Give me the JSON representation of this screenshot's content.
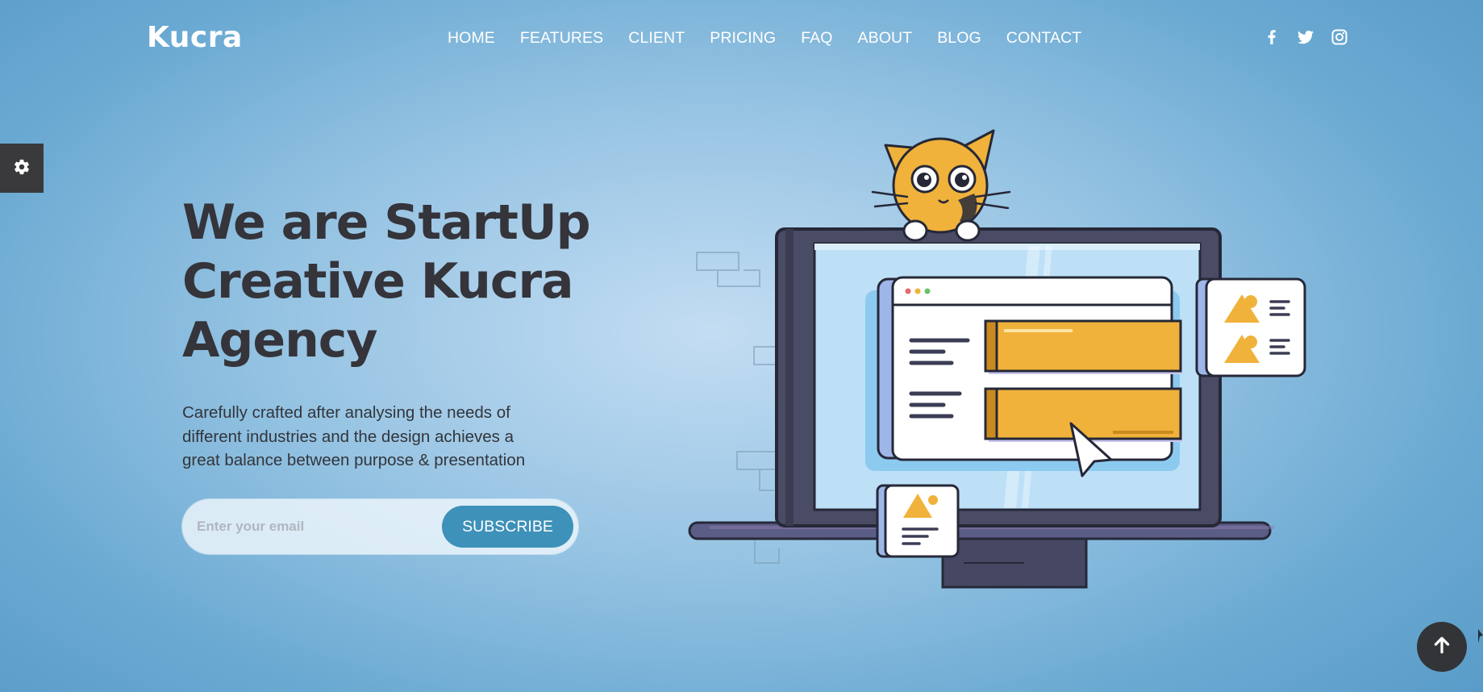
{
  "brand": {
    "logo_text": "Kucra"
  },
  "nav": {
    "items": [
      "HOME",
      "FEATURES",
      "CLIENT",
      "PRICING",
      "FAQ",
      "ABOUT",
      "BLOG",
      "CONTACT"
    ]
  },
  "social": {
    "icons": [
      "facebook-icon",
      "twitter-icon",
      "instagram-icon"
    ]
  },
  "settings_panel": {
    "icon": "gear-icon"
  },
  "hero": {
    "title_lines": [
      "We are StartUp",
      "Creative Kucra",
      "Agency"
    ],
    "description_lines": [
      "Carefully crafted after analysing the needs of",
      "different industries and the design achieves a",
      "great balance between purpose & presentation"
    ],
    "email_placeholder": "Enter your email",
    "subscribe_label": "SUBSCRIBE"
  },
  "back_to_top": {
    "icon": "arrow-up-icon"
  },
  "colors": {
    "background_center": "#c3ddf3",
    "background_edge": "#5498c6",
    "accent_button": "#3e91b9",
    "heading": "#34343a",
    "dark_ui": "#333437",
    "illustration_yellow": "#f0b23a"
  }
}
